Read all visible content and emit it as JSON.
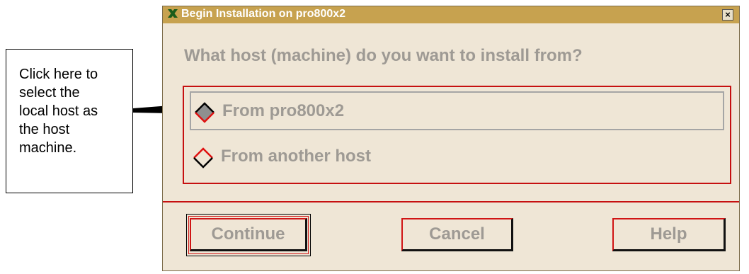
{
  "callout": {
    "lines": [
      "Click here to",
      "select the",
      "local host as",
      "the host",
      "machine."
    ]
  },
  "window": {
    "title": "Begin Installation on pro800x2",
    "close_glyph": "×",
    "question": "What host (machine) do you want to install from?",
    "options": [
      {
        "label": "From pro800x2",
        "selected": true
      },
      {
        "label": "From another host",
        "selected": false
      }
    ],
    "buttons": {
      "continue": "Continue",
      "cancel": "Cancel",
      "help": "Help"
    }
  },
  "colors": {
    "titlebar": "#c7a24f",
    "window_bg": "#efe6d6",
    "accent_red": "#c61010",
    "disabled_text": "#9e9a94"
  }
}
